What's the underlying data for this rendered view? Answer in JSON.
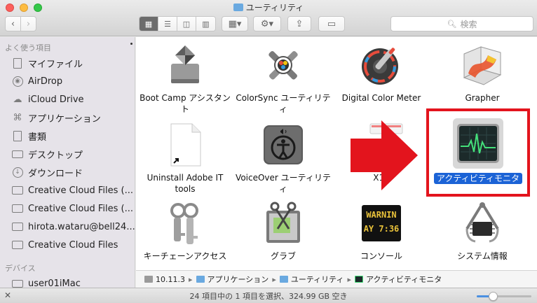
{
  "window": {
    "title": "ユーティリティ"
  },
  "toolbar": {
    "back_icon": "chevron-left-icon",
    "forward_icon": "chevron-right-icon",
    "view_modes": [
      "icon-view",
      "list-view",
      "column-view",
      "coverflow-view"
    ],
    "active_view": "icon-view",
    "arrange_icon": "arrange-grid-icon",
    "action_icon": "gear-icon",
    "share_icon": "share-icon",
    "tags_icon": "tag-icon",
    "search_placeholder": "検索"
  },
  "sidebar": {
    "favorites_heading": "よく使う項目",
    "items": [
      {
        "label": "マイファイル",
        "icon": "all-my-files-icon"
      },
      {
        "label": "AirDrop",
        "icon": "airdrop-icon"
      },
      {
        "label": "iCloud Drive",
        "icon": "cloud-icon"
      },
      {
        "label": "アプリケーション",
        "icon": "applications-icon"
      },
      {
        "label": "書類",
        "icon": "document-icon"
      },
      {
        "label": "デスクトップ",
        "icon": "desktop-icon"
      },
      {
        "label": "ダウンロード",
        "icon": "download-icon"
      },
      {
        "label": "Creative Cloud Files (...",
        "icon": "folder-icon"
      },
      {
        "label": "Creative Cloud Files (...",
        "icon": "folder-icon"
      },
      {
        "label": "hirota.wataru@bell24...",
        "icon": "folder-icon"
      },
      {
        "label": "Creative Cloud Files",
        "icon": "folder-icon"
      }
    ],
    "devices_heading": "デバイス",
    "devices": [
      {
        "label": "user01iMac",
        "icon": "imac-icon"
      }
    ]
  },
  "items": [
    {
      "label": "Boot Camp アシスタント",
      "icon": "bootcamp-icon",
      "selected": false
    },
    {
      "label": "ColorSync ユーティリティ",
      "icon": "colorsync-icon",
      "selected": false
    },
    {
      "label": "Digital Color Meter",
      "icon": "digital-color-meter-icon",
      "selected": false
    },
    {
      "label": "Grapher",
      "icon": "grapher-icon",
      "selected": false
    },
    {
      "label": "Uninstall Adobe IT tools",
      "icon": "alias-document-icon",
      "selected": false
    },
    {
      "label": "VoiceOver ユーティリティ",
      "icon": "voiceover-icon",
      "selected": false
    },
    {
      "label": "X11",
      "icon": "x11-icon",
      "selected": false
    },
    {
      "label": "アクティビティモニタ",
      "icon": "activity-monitor-icon",
      "selected": true
    },
    {
      "label": "キーチェーンアクセス",
      "icon": "keychain-icon",
      "selected": false
    },
    {
      "label": "グラブ",
      "icon": "grab-icon",
      "selected": false
    },
    {
      "label": "コンソール",
      "icon": "console-icon",
      "selected": false
    },
    {
      "label": "システム情報",
      "icon": "system-information-icon",
      "selected": false
    }
  ],
  "console_icon_text": [
    "WARNIN",
    "AY 7:36"
  ],
  "annotation": {
    "arrow_color": "#e3141d",
    "box_color": "#e3141d"
  },
  "pathbar": [
    {
      "label": "10.11.3",
      "icon": "disk-icon"
    },
    {
      "label": "アプリケーション",
      "icon": "folder-icon"
    },
    {
      "label": "ユーティリティ",
      "icon": "folder-icon"
    },
    {
      "label": "アクティビティモニタ",
      "icon": "activity-monitor-icon"
    }
  ],
  "status": {
    "text": "24 項目中の 1 項目を選択、324.99 GB 空き",
    "icon_size_fraction": 0.3
  },
  "colors": {
    "selection": "#1b63d6",
    "sidebar_bg": "#e6e3e9"
  }
}
